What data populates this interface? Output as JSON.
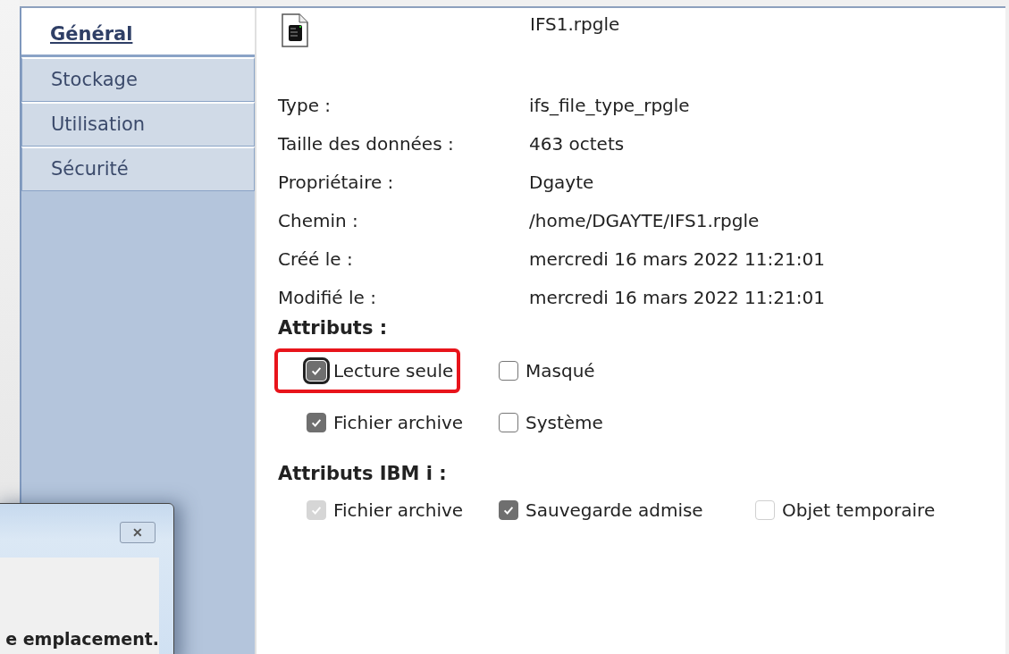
{
  "tabs": [
    {
      "label": "Général",
      "selected": true
    },
    {
      "label": "Stockage",
      "selected": false
    },
    {
      "label": "Utilisation",
      "selected": false
    },
    {
      "label": "Sécurité",
      "selected": false
    }
  ],
  "file": {
    "name": "IFS1.rpgle"
  },
  "properties": [
    {
      "label": "Type :",
      "value": "ifs_file_type_rpgle"
    },
    {
      "label": "Taille des données :",
      "value": "463 octets"
    },
    {
      "label": "Propriétaire :",
      "value": "Dgayte"
    },
    {
      "label": "Chemin :",
      "value": "/home/DGAYTE/IFS1.rpgle"
    },
    {
      "label": "Créé le :",
      "value": "mercredi 16 mars 2022 11:21:01"
    },
    {
      "label": "Modifié le :",
      "value": "mercredi 16 mars 2022 11:21:01"
    }
  ],
  "attributes": {
    "title": "Attributs :",
    "rows": [
      [
        {
          "label": "Lecture seule",
          "checked": true,
          "disabled": false,
          "highlighted": true
        },
        {
          "label": "Masqué",
          "checked": false,
          "disabled": false,
          "highlighted": false
        }
      ],
      [
        {
          "label": "Fichier archive",
          "checked": true,
          "disabled": false,
          "highlighted": false
        },
        {
          "label": "Système",
          "checked": false,
          "disabled": false,
          "highlighted": false
        }
      ]
    ]
  },
  "ibm_attributes": {
    "title": "Attributs IBM i :",
    "items": [
      {
        "label": "Fichier archive",
        "checked": true,
        "disabled": true
      },
      {
        "label": "Sauvegarde admise",
        "checked": true,
        "disabled": false
      },
      {
        "label": "Objet temporaire",
        "checked": false,
        "disabled": true
      }
    ]
  },
  "dialog": {
    "close": "✕",
    "message": "e emplacement."
  }
}
